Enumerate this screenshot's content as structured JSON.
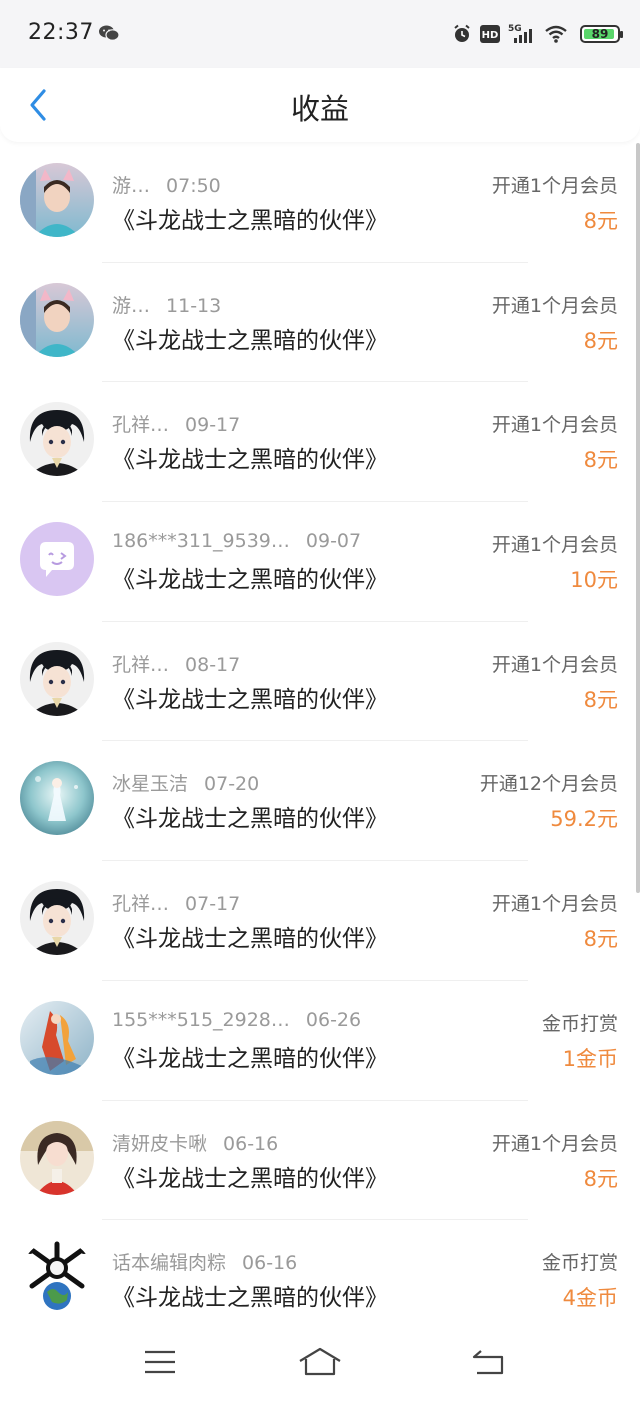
{
  "status": {
    "time": "22:37",
    "battery": "89",
    "network": "5G",
    "hd": "HD"
  },
  "header": {
    "title": "收益"
  },
  "items": [
    {
      "name": "游…",
      "date": "07:50",
      "book": "《斗龙战士之黑暗的伙伴》",
      "type": "开通1个月会员",
      "amount": "8元",
      "avatar": "girl-cat-ears"
    },
    {
      "name": "游…",
      "date": "11-13",
      "book": "《斗龙战士之黑暗的伙伴》",
      "type": "开通1个月会员",
      "amount": "8元",
      "avatar": "girl-cat-ears"
    },
    {
      "name": "孔祥…",
      "date": "09-17",
      "book": "《斗龙战士之黑暗的伙伴》",
      "type": "开通1个月会员",
      "amount": "8元",
      "avatar": "anime-boy"
    },
    {
      "name": "186***311_9539…",
      "date": "09-07",
      "book": "《斗龙战士之黑暗的伙伴》",
      "type": "开通1个月会员",
      "amount": "10元",
      "avatar": "default-chat"
    },
    {
      "name": "孔祥…",
      "date": "08-17",
      "book": "《斗龙战士之黑暗的伙伴》",
      "type": "开通1个月会员",
      "amount": "8元",
      "avatar": "anime-boy"
    },
    {
      "name": "冰星玉洁",
      "date": "07-20",
      "book": "《斗龙战士之黑暗的伙伴》",
      "type": "开通12个月会员",
      "amount": "59.2元",
      "avatar": "ice-fairy"
    },
    {
      "name": "孔祥…",
      "date": "07-17",
      "book": "《斗龙战士之黑暗的伙伴》",
      "type": "开通1个月会员",
      "amount": "8元",
      "avatar": "anime-boy"
    },
    {
      "name": "155***515_2928…",
      "date": "06-26",
      "book": "《斗龙战士之黑暗的伙伴》",
      "type": "金币打赏",
      "amount": "1金币",
      "avatar": "fire-hero"
    },
    {
      "name": "清妍皮卡啾",
      "date": "06-16",
      "book": "《斗龙战士之黑暗的伙伴》",
      "type": "开通1个月会员",
      "amount": "8元",
      "avatar": "girl-red"
    },
    {
      "name": "话本编辑肉粽",
      "date": "06-16",
      "book": "《斗龙战士之黑暗的伙伴》",
      "type": "金币打赏",
      "amount": "4金币",
      "avatar": "bone-earth"
    }
  ],
  "colors": {
    "accent": "#2f8de4",
    "amount": "#ef8a3e"
  }
}
